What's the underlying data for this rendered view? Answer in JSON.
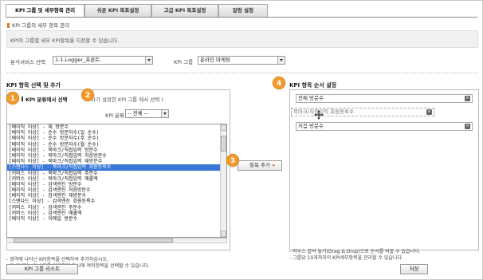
{
  "tabs": [
    {
      "label": "KPI 그룹 및 세부항목 관리",
      "active": true
    },
    {
      "label": "쉬운 KPI 목표설정",
      "active": false
    },
    {
      "label": "고급 KPI 목표설정",
      "active": false
    },
    {
      "label": "알람 설정",
      "active": false
    }
  ],
  "subtitle": "KPI 그룹의 세부 항목 관리",
  "description": "KPI의 그룹별 세부 KPI항목을 지정할 수 있습니다.",
  "filters": {
    "service_label": "분석서비스 선택",
    "service_value": "1-1.Logger_프론트.",
    "group_label": "KPI 그룹",
    "group_value": "온라인 마케팅"
  },
  "left_section": {
    "title": "KPI 항목 선택 및 추가",
    "category_heading": "KPI 분류에서 선택",
    "category_hint": "자가 설정한 KPI 그룹 에서 선택 )",
    "category_label": "KPI 분류",
    "category_value": "-- 전체 --",
    "items": [
      "[베이직   이상] - 재 방문수",
      "[베이직   이상] - 순수 방문자수(일 순수)",
      "[베이직   이상] - 순수 방문자수(주 순수)",
      "[베이직   이상] - 순수 방문자수(월 순수)",
      "[베이직   이상] - 북마크/직접입력 방문수",
      "[베이직   이상] - 북마크/직접입력 처음방문수",
      "[베이직   이상] - 북마크/직접입력 재방문수",
      "[스탠다드 이상] - 북마크/직접입력 회원등록수",
      "[커머스   이상] - 북마크/직접입력 주문수",
      "[커머스   이상] - 북마크/직접입력 매출액",
      "[베이직   이상] - 검색엔진 방문수",
      "[베이직   이상] - 검색엔진 처음방문수",
      "[베이직   이상] - 검색엔진 재방문수",
      "[스탠다드 이상] - 검색엔진 회원등록수",
      "[커머스   이상] - 검색엔진 주문수",
      "[커머스   이상] - 검색엔진 매출액",
      "[베이직   이상] - 이메일 방문수"
    ],
    "selected_index": 7,
    "add_button": "항목 추가",
    "add_button_arrow": "»",
    "notes": [
      "- 영역에 나타난 KPI항목을 선택하여 추가하십시오.",
      "- Shift 또는 Ctrl 키를 이용하여 동시에 여러항목을 선택할 수 있습니다."
    ]
  },
  "right_section": {
    "title": "KPI 항목 순서 설정",
    "items": [
      "전체 방문수",
      "북마크/직접입력 회원등록수",
      "처음 방문수"
    ],
    "notes": [
      "- 마우스 끌어 놓기(Drag & Drop)으로 순서를 바꿀 수 있습니다.",
      "- 그룹당 10개까지의 KPI세부항목을 관리할 수 있습니다."
    ],
    "save_button": "저장"
  },
  "group_list_button": "KPI 그룹 리스트",
  "badges": [
    "1",
    "2",
    "3",
    "4"
  ],
  "colors": {
    "accent": "#f39b2c",
    "selection": "#3978d6"
  }
}
